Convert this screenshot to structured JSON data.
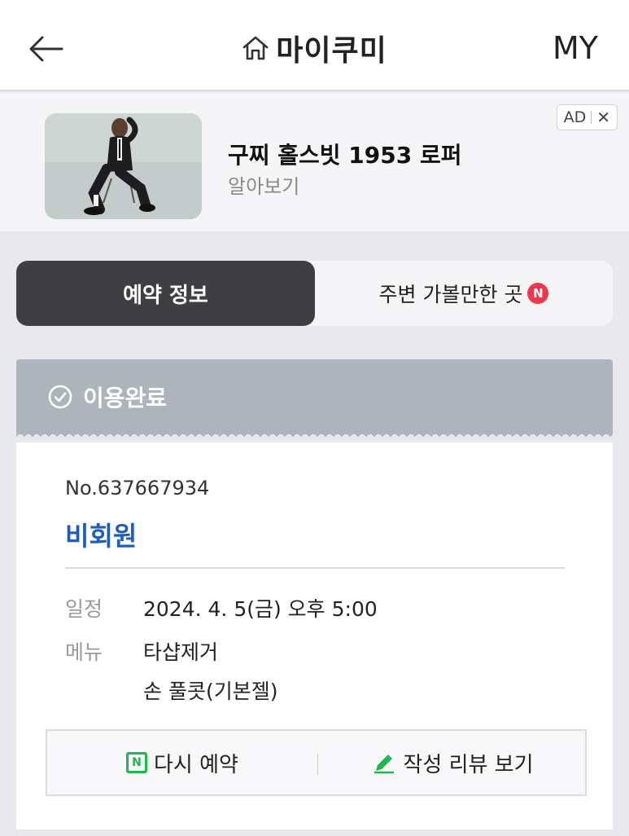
{
  "header": {
    "title": "마이쿠미",
    "my_label": "MY",
    "icons": {
      "back": "back-arrow-icon",
      "home": "home-icon"
    }
  },
  "ad": {
    "title": "구찌 홀스빗 1953 로퍼",
    "subtitle": "알아보기",
    "badge_label": "AD",
    "close_label": "✕"
  },
  "tabs": {
    "active_label": "예약 정보",
    "inactive_label": "주변 가볼만한 곳",
    "new_badge": "N"
  },
  "status": {
    "label": "이용완료",
    "icon": "check-circle-icon",
    "color": "#adb4bc"
  },
  "reservation": {
    "number": "No.637667934",
    "member_type": "비회원",
    "schedule_label": "일정",
    "schedule_value": "2024. 4. 5(금) 오후 5:00",
    "menu_label": "메뉴",
    "menu_items": [
      "타샵제거",
      "손 풀콧(기본젤)"
    ]
  },
  "actions": {
    "rebook_label": "다시 예약",
    "rebook_icon_text": "N",
    "review_label": "작성 리뷰 보기"
  },
  "colors": {
    "accent_blue": "#1f5eb8",
    "naver_green": "#1fb84a",
    "badge_red": "#f0364a",
    "dark_tab": "#3f3e43"
  }
}
